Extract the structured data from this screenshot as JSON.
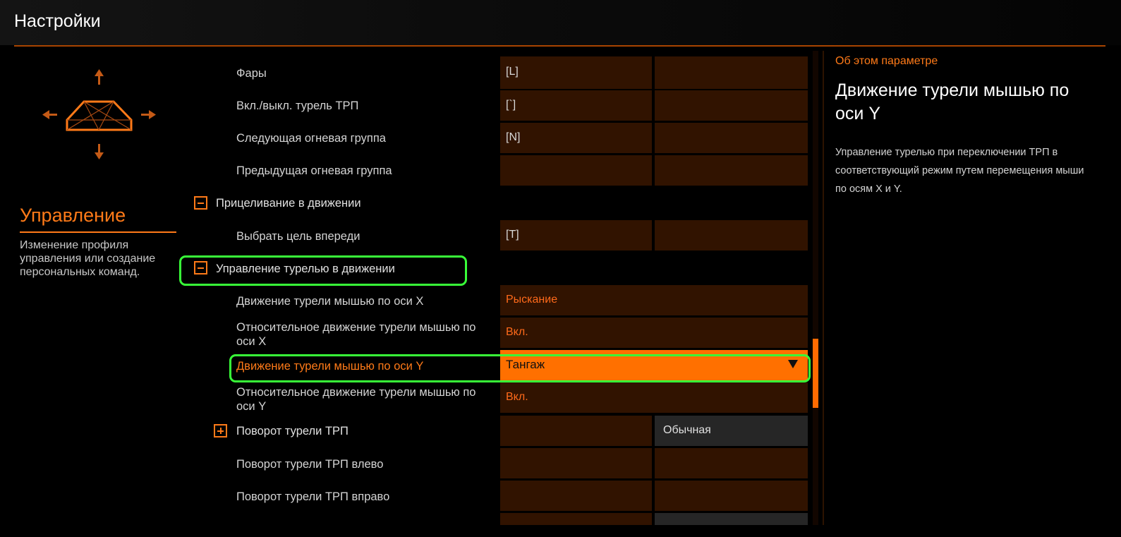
{
  "header": {
    "title": "Настройки"
  },
  "sidebar": {
    "section_title": "Управление",
    "section_desc": "Изменение профиля управления или создание персональных команд."
  },
  "rows": {
    "headlights": {
      "label": "Фары",
      "primary": "[L]",
      "secondary": ""
    },
    "trp_turret_toggle": {
      "label": "Вкл./выкл. турель ТРП",
      "primary": "[`]",
      "secondary": ""
    },
    "next_fire_group": {
      "label": "Следующая огневая группа",
      "primary": "[N]",
      "secondary": ""
    },
    "prev_fire_group": {
      "label": "Предыдущая огневая группа",
      "primary": "",
      "secondary": ""
    },
    "aiming_group": {
      "label": "Прицеливание в движении"
    },
    "select_target_ahead": {
      "label": "Выбрать цель впереди",
      "primary": "[T]",
      "secondary": ""
    },
    "turret_control_group": {
      "label": "Управление турелью в движении"
    },
    "turret_mouse_x": {
      "label": "Движение турели мышью по оси X",
      "value": "Рыскание"
    },
    "relative_turret_x": {
      "label": "Относительное движение турели мышью по оси X",
      "value": "Вкл."
    },
    "turret_mouse_y": {
      "label": "Движение турели мышью по оси Y",
      "value": "Тангаж"
    },
    "relative_turret_y": {
      "label": "Относительное движение турели мышью по оси Y",
      "value": "Вкл."
    },
    "trp_turret_rotation_group": {
      "label": "Поворот турели ТРП",
      "primary": "",
      "secondary": "Обычная"
    },
    "trp_turret_left": {
      "label": "Поворот турели ТРП влево",
      "primary": "",
      "secondary": ""
    },
    "trp_turret_right": {
      "label": "Поворот турели ТРП вправо",
      "primary": "",
      "secondary": ""
    }
  },
  "about": {
    "label": "Об этом параметре",
    "title": "Движение турели мышью по оси Y",
    "description": "Управление турелью при переключении ТРП в соответствующий режим путем перемещения мыши по осям X и Y."
  },
  "colors": {
    "accent": "#ff7a18",
    "cell_bg": "#311300",
    "highlight": "#38ff38"
  },
  "icons": {
    "directional": "ship-directional-icon",
    "collapse": "minus-box-icon",
    "expand": "plus-box-icon",
    "dropdown": "triangle-down-icon"
  }
}
